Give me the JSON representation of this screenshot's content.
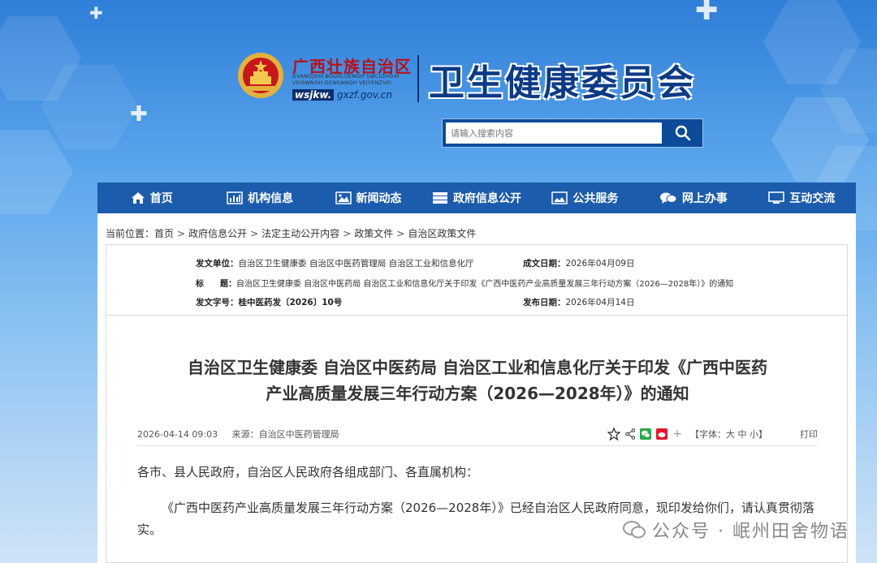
{
  "header": {
    "region_name": "广西壮族自治区",
    "pinyin": "GVANGJSIH BOUXCUENGH SWCIGHGIH VEISWNGH GENGANGH VEIYENZVEI",
    "domain_prefix": "wsjkw.",
    "domain_suffix": "gxzf.gov.cn",
    "site_title": "卫生健康委员会"
  },
  "search": {
    "placeholder": "请输入搜索内容"
  },
  "nav": {
    "items": [
      {
        "label": "首页",
        "icon": "home-icon"
      },
      {
        "label": "机构信息",
        "icon": "bar-chart-icon"
      },
      {
        "label": "新闻动态",
        "icon": "image-icon"
      },
      {
        "label": "政府信息公开",
        "icon": "stack-icon"
      },
      {
        "label": "公共服务",
        "icon": "picture-icon"
      },
      {
        "label": "网上办事",
        "icon": "chat-icon"
      },
      {
        "label": "互动交流",
        "icon": "monitor-icon"
      }
    ]
  },
  "breadcrumb": {
    "prefix": "当前位置：",
    "items": [
      "首页",
      "政府信息公开",
      "法定主动公开内容",
      "政策文件",
      "自治区政策文件"
    ]
  },
  "meta": {
    "issuer_key": "发文单位：",
    "issuer_val": "自治区卫生健康委 自治区中医药管理局 自治区工业和信息化厅",
    "created_key": "成文日期：",
    "created_val": "2026年04月09日",
    "title_key": "标　　题：",
    "title_val": "自治区卫生健康委 自治区中医药局 自治区工业和信息化厅关于印发《广西中医药产业高质量发展三年行动方案（2026—2028年）》的通知",
    "docno_key": "发文字号：",
    "docno_val": "桂中医药发〔2026〕10号",
    "published_key": "发布日期：",
    "published_val": "2026年04月14日"
  },
  "article": {
    "title_line1": "自治区卫生健康委 自治区中医药局 自治区工业和信息化厅关于印发《广西中医药",
    "title_line2": "产业高质量发展三年行动方案（2026—2028年）》的通知",
    "datetime": "2026-04-14 09:03",
    "source_label": "来源：",
    "source": "自治区中医药管理局",
    "font_size_label": "【字体：大 中 小】",
    "print_label": "打印",
    "salutation": "各市、县人民政府，自治区人民政府各组成部门、各直属机构：",
    "body": "《广西中医药产业高质量发展三年行动方案（2026—2028年）》已经自治区人民政府同意，现印发给你们，请认真贯彻落实。"
  },
  "watermark": {
    "text": "公众号 · 岷州田舍物语"
  },
  "colors": {
    "nav_bg": "#1b5cac",
    "title_blue": "#0c3a86",
    "emblem_red": "#c8161d"
  }
}
